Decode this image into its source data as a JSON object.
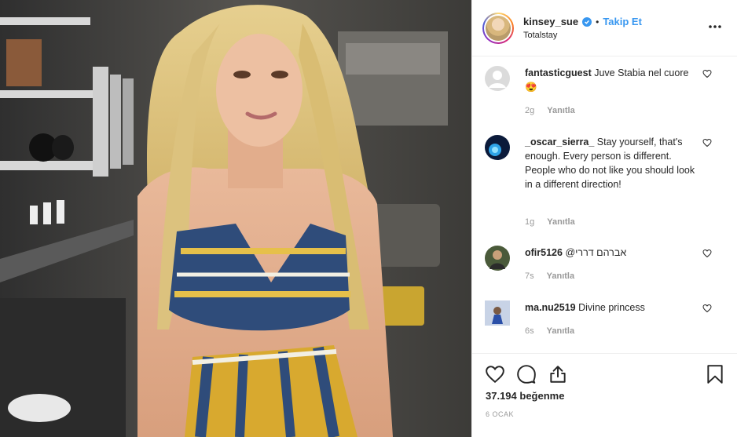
{
  "post": {
    "image_alt": "Photo post by kinsey_sue",
    "author": {
      "username": "kinsey_sue",
      "verified": true,
      "separator": "•",
      "follow_label": "Takip Et",
      "location": "Totalstay"
    },
    "more_icon": "more-horizontal-icon"
  },
  "comments": [
    {
      "username": "fantasticguest",
      "text": "Juve Stabia nel cuore",
      "emoji": "😍",
      "age": "2g",
      "reply_label": "Yanıtla",
      "avatar_color": "#dbdbdb"
    },
    {
      "username": "_oscar_sierra_",
      "text": "Stay yourself, that's enough. Every person is different. People who do not like you should look in a different direction!",
      "age": "1g",
      "reply_label": "Yanıtla",
      "avatar_color": "#0b1a3a"
    },
    {
      "username": "ofir5126",
      "text": "@אברהם דררי",
      "age": "7s",
      "reply_label": "Yanıtla",
      "avatar_color": "#4a5a3a"
    },
    {
      "username": "ma.nu2519",
      "text": "Divine princess",
      "age": "6s",
      "reply_label": "Yanıtla",
      "avatar_color": "#6b7fa8"
    }
  ],
  "actions": {
    "likes": "37.194 beğenme",
    "date": "6 OCAK"
  },
  "colors": {
    "link_blue": "#3897f0",
    "muted_gray": "#999999",
    "border": "#efefef"
  }
}
